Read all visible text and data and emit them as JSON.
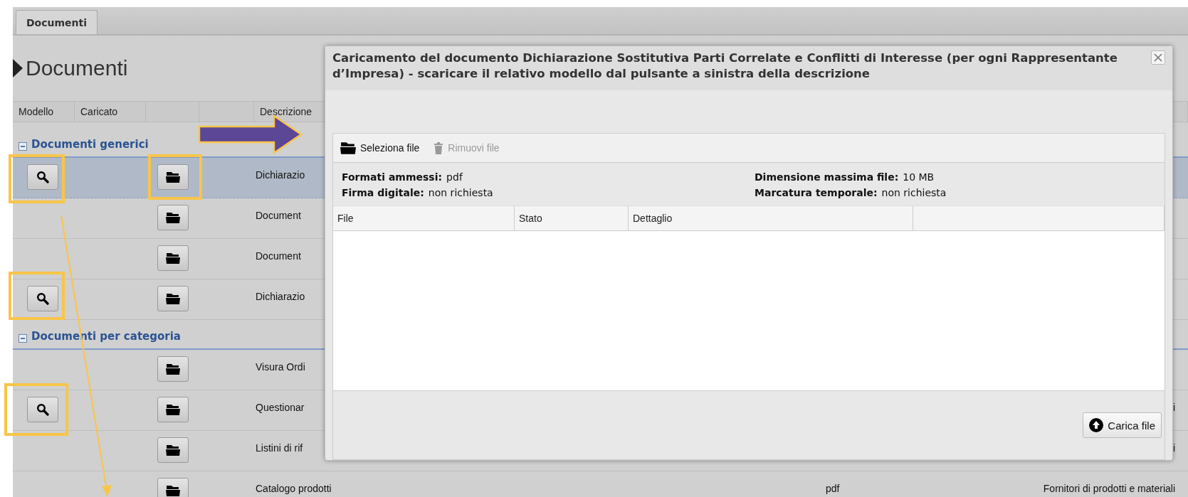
{
  "tabs": [
    {
      "label": "Documenti",
      "selected": true
    }
  ],
  "heading": "Documenti",
  "table": {
    "columns": [
      "Modello",
      "Caricato",
      "Descrizione"
    ],
    "groups": [
      {
        "label": "Documenti generici",
        "expanded": true,
        "rows": [
          {
            "has_template": true,
            "description": "Dichiarazio",
            "selected": true
          },
          {
            "has_template": false,
            "description": "Document",
            "selected": false
          },
          {
            "has_template": false,
            "description": "Document",
            "selected": false
          },
          {
            "has_template": true,
            "description": "Dichiarazio",
            "selected": false
          }
        ]
      },
      {
        "label": "Documenti per categoria",
        "expanded": true,
        "rows": [
          {
            "has_template": false,
            "description": "Visura Ordi",
            "selected": false
          },
          {
            "has_template": true,
            "description": "Questionar",
            "column_7": "i",
            "selected": false
          },
          {
            "has_template": false,
            "description": "Listini di rif",
            "column_7": "i",
            "selected": false
          },
          {
            "has_template": false,
            "description": "Catalogo prodotti",
            "column_6": "pdf",
            "column_7": "Fornitori di prodotti e materiali",
            "selected": false
          }
        ]
      }
    ]
  },
  "dialog": {
    "title": "Caricamento del documento Dichiarazione Sostitutiva Parti Correlate e Conflitti di Interesse (per ogni Rappresentante d’Impresa) - scaricare il relativo modello dal pulsante a sinistra della descrizione",
    "toolbar": [
      {
        "kind": "select",
        "label": "Seleziona file",
        "disabled": false
      },
      {
        "kind": "remove",
        "label": "Rimuovi file",
        "disabled": true
      }
    ],
    "info": [
      {
        "label": "Formati ammessi:",
        "value": "pdf"
      },
      {
        "label": "Dimensione massima file:",
        "value": "10 MB"
      },
      {
        "label": "Firma digitale:",
        "value": "non richiesta"
      },
      {
        "label": "Marcatura temporale:",
        "value": "non richiesta"
      }
    ],
    "grid_columns": [
      "File",
      "Stato",
      "Dettaglio"
    ],
    "upload_button": "Carica file"
  }
}
